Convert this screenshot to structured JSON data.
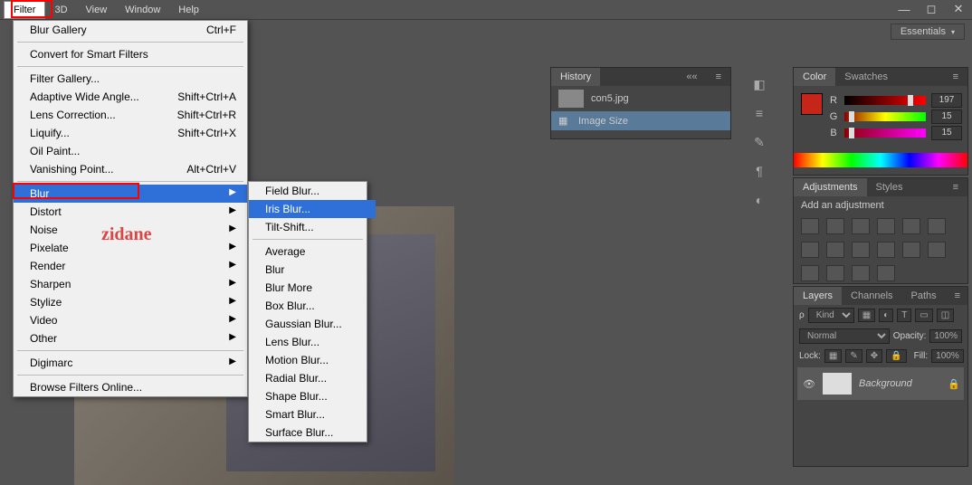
{
  "menubar": [
    "Filter",
    "3D",
    "View",
    "Window",
    "Help"
  ],
  "workspace": "Essentials",
  "filter_menu": {
    "group1": [
      {
        "label": "Blur Gallery",
        "shortcut": "Ctrl+F"
      }
    ],
    "group2": [
      {
        "label": "Convert for Smart Filters"
      }
    ],
    "group3": [
      {
        "label": "Filter Gallery..."
      },
      {
        "label": "Adaptive Wide Angle...",
        "shortcut": "Shift+Ctrl+A"
      },
      {
        "label": "Lens Correction...",
        "shortcut": "Shift+Ctrl+R"
      },
      {
        "label": "Liquify...",
        "shortcut": "Shift+Ctrl+X"
      },
      {
        "label": "Oil Paint..."
      },
      {
        "label": "Vanishing Point...",
        "shortcut": "Alt+Ctrl+V"
      }
    ],
    "group4": [
      {
        "label": "Blur",
        "arrow": true,
        "sel": true
      },
      {
        "label": "Distort",
        "arrow": true
      },
      {
        "label": "Noise",
        "arrow": true
      },
      {
        "label": "Pixelate",
        "arrow": true
      },
      {
        "label": "Render",
        "arrow": true
      },
      {
        "label": "Sharpen",
        "arrow": true
      },
      {
        "label": "Stylize",
        "arrow": true
      },
      {
        "label": "Video",
        "arrow": true
      },
      {
        "label": "Other",
        "arrow": true
      }
    ],
    "group5": [
      {
        "label": "Digimarc",
        "arrow": true
      }
    ],
    "group6": [
      {
        "label": "Browse Filters Online..."
      }
    ]
  },
  "blur_submenu": [
    {
      "label": "Field Blur..."
    },
    {
      "label": "Iris Blur...",
      "sel": true
    },
    {
      "label": "Tilt-Shift..."
    },
    {
      "sep": true
    },
    {
      "label": "Average"
    },
    {
      "label": "Blur"
    },
    {
      "label": "Blur More"
    },
    {
      "label": "Box Blur..."
    },
    {
      "label": "Gaussian Blur..."
    },
    {
      "label": "Lens Blur..."
    },
    {
      "label": "Motion Blur..."
    },
    {
      "label": "Radial Blur..."
    },
    {
      "label": "Shape Blur..."
    },
    {
      "label": "Smart Blur..."
    },
    {
      "label": "Surface Blur..."
    }
  ],
  "annotation": "zidane",
  "history": {
    "title": "History",
    "file": "con5.jpg",
    "steps": [
      "Image Size"
    ]
  },
  "color": {
    "tabs": [
      "Color",
      "Swatches"
    ],
    "r": "197",
    "g": "15",
    "b": "15"
  },
  "adjustments": {
    "tabs": [
      "Adjustments",
      "Styles"
    ],
    "label": "Add an adjustment"
  },
  "layers": {
    "tabs": [
      "Layers",
      "Channels",
      "Paths"
    ],
    "kind": "Kind",
    "mode": "Normal",
    "opacity_label": "Opacity:",
    "opacity": "100%",
    "lock_label": "Lock:",
    "fill_label": "Fill:",
    "fill": "100%",
    "layer": {
      "name": "Background"
    }
  }
}
